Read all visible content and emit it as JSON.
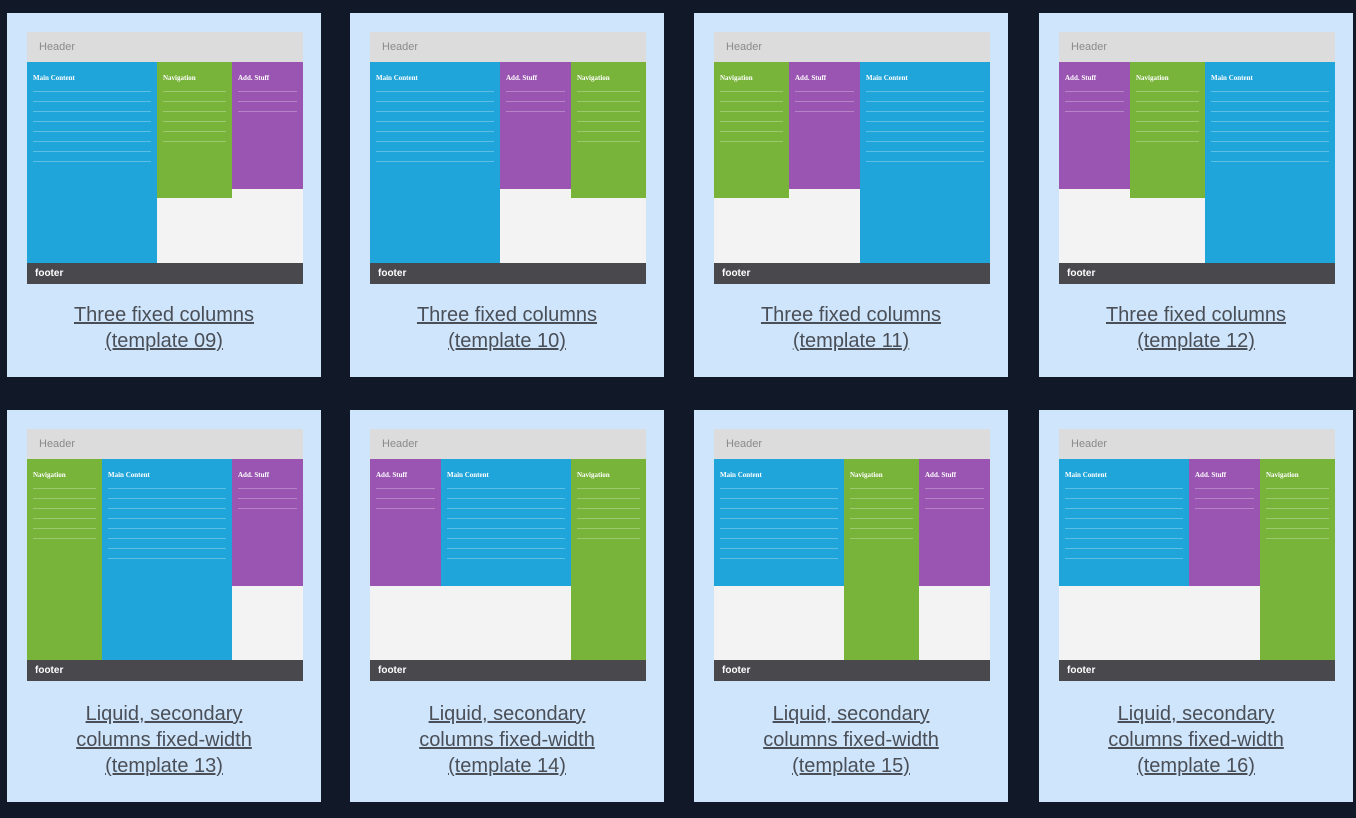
{
  "thumbnail_text": {
    "header": "Header",
    "footer": "footer",
    "main": "Main Content",
    "nav": "Navigation",
    "add": "Add. Stuff"
  },
  "colors": {
    "page_background": "#111827",
    "card_background": "#cfe5fb",
    "main_content": "#1fa5d9",
    "navigation": "#79b43a",
    "add_stuff": "#9a54b1",
    "header_bar": "#dcdcdc",
    "footer_bar": "#48484d"
  },
  "templates": [
    {
      "number": "09",
      "caption_lines": [
        "Three fixed columns",
        "(template 09)"
      ]
    },
    {
      "number": "10",
      "caption_lines": [
        "Three fixed columns",
        "(template 10)"
      ]
    },
    {
      "number": "11",
      "caption_lines": [
        "Three fixed columns",
        "(template 11)"
      ]
    },
    {
      "number": "12",
      "caption_lines": [
        "Three fixed columns",
        "(template 12)"
      ]
    },
    {
      "number": "13",
      "caption_lines": [
        "Liquid, secondary",
        "columns fixed-width",
        "(template 13)"
      ]
    },
    {
      "number": "14",
      "caption_lines": [
        "Liquid, secondary",
        "columns fixed-width",
        "(template 14)"
      ]
    },
    {
      "number": "15",
      "caption_lines": [
        "Liquid, secondary",
        "columns fixed-width",
        "(template 15)"
      ]
    },
    {
      "number": "16",
      "caption_lines": [
        "Liquid, secondary",
        "columns fixed-width",
        "(template 16)"
      ]
    }
  ]
}
